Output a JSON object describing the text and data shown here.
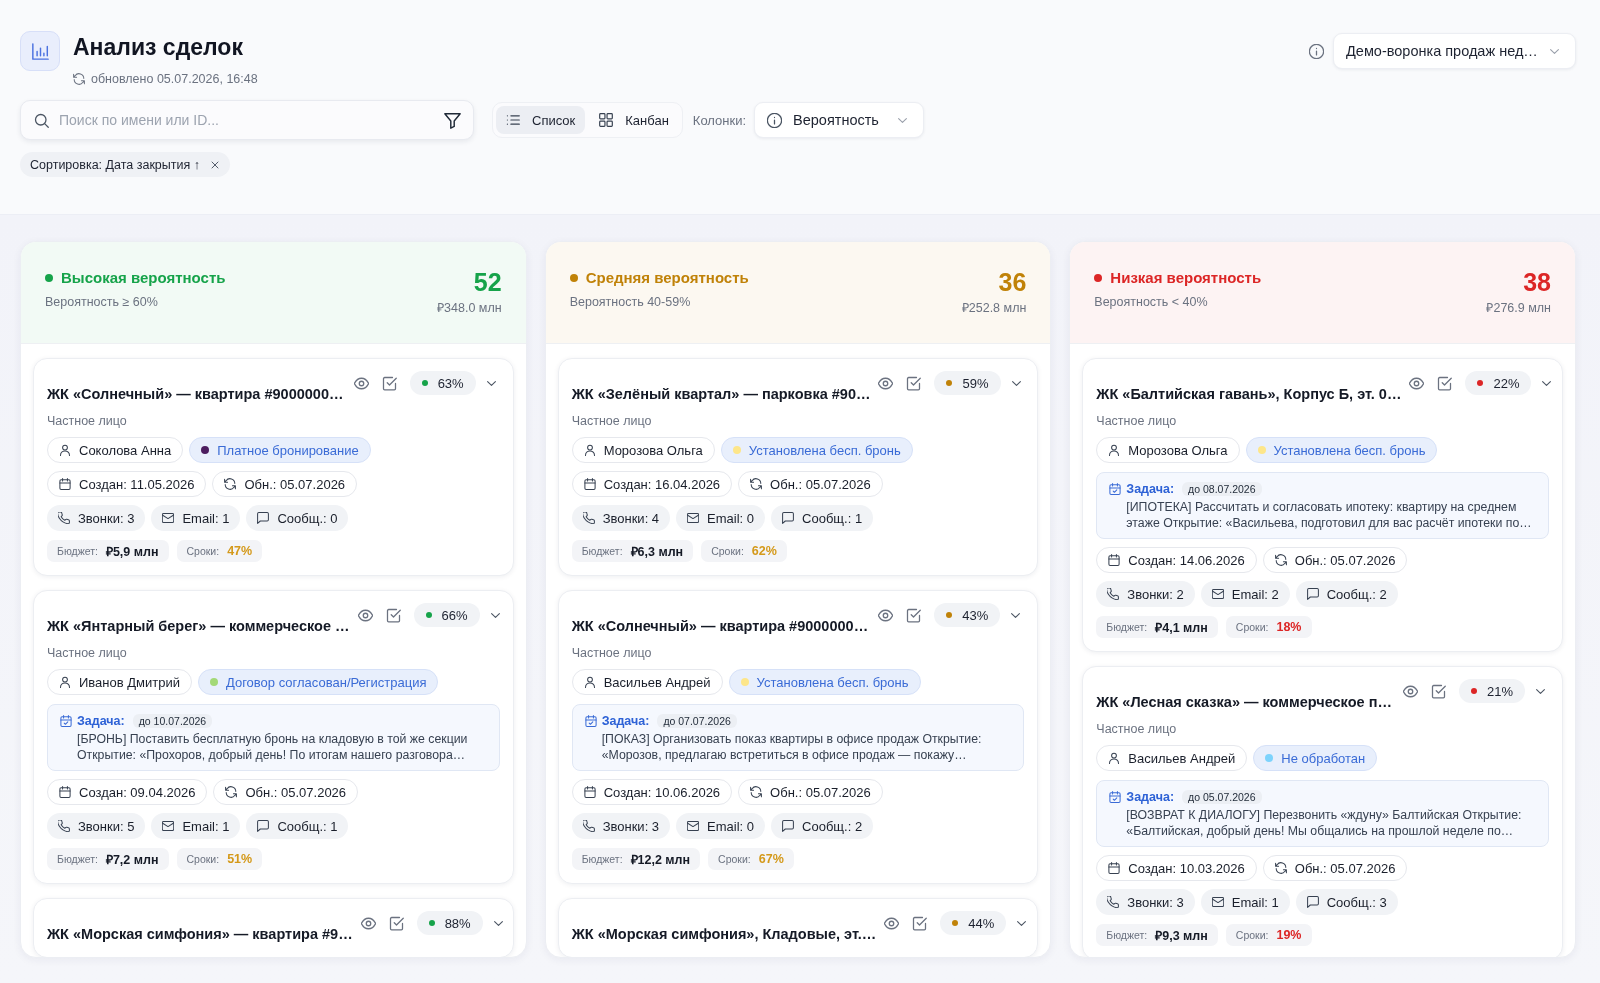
{
  "header": {
    "title": "Анализ сделок",
    "updated": "обновлено 05.07.2026, 16:48",
    "funnel_select": {
      "value": "Демо-воронка продаж нед…"
    }
  },
  "toolbar": {
    "search": {
      "placeholder": "Поиск по имени или ID..."
    },
    "views": [
      {
        "label": "Список",
        "kind": "list",
        "selected": true
      },
      {
        "label": "Канбан",
        "kind": "kanban",
        "selected": false
      }
    ],
    "columns_label": "Колонки:",
    "columns_select": {
      "value": "Вероятность"
    }
  },
  "sort_chip": {
    "label": "Сортировка: Дата закрытия ↑"
  },
  "columns": [
    {
      "title": "Высокая вероятность",
      "subtitle": "Вероятность ≥ 60%",
      "count": "52",
      "sum": "₽348.0 млн",
      "color": "#16a34a",
      "cards": [
        {
          "title": "ЖК «Солнечный» — квартира #9000000…",
          "probability": "63%",
          "client_type": "Частное лицо",
          "person": "Соколова Анна",
          "status": {
            "label": "Платное бронирование",
            "color": "#4c1d5f"
          },
          "created": "Создан: 11.05.2026",
          "updated": "Обн.: 05.07.2026",
          "calls": "Звонки: 3",
          "emails": "Email: 1",
          "messages": "Сообщ.: 0",
          "budget": {
            "label": "Бюджет:",
            "value": "₽5,9 млн"
          },
          "deadline": {
            "label": "Сроки:",
            "value": "47%",
            "color": "#d4991a"
          }
        },
        {
          "title": "ЖК «Янтарный берег» — коммерческое …",
          "probability": "66%",
          "client_type": "Частное лицо",
          "person": "Иванов Дмитрий",
          "status": {
            "label": "Договор согласован/Регистрация",
            "color": "#a3d977"
          },
          "task": {
            "label": "Задача:",
            "due": "до 10.07.2026",
            "lines": [
              "[БРОНЬ] Поставить бесплатную бронь на кладовую в той же секции",
              "Открытие: «Прохоров, добрый день! По итогам нашего разговора…"
            ]
          },
          "created": "Создан: 09.04.2026",
          "updated": "Обн.: 05.07.2026",
          "calls": "Звонки: 5",
          "emails": "Email: 1",
          "messages": "Сообщ.: 1",
          "budget": {
            "label": "Бюджет:",
            "value": "₽7,2 млн"
          },
          "deadline": {
            "label": "Сроки:",
            "value": "51%",
            "color": "#d4991a"
          }
        },
        {
          "title": "ЖК «Морская симфония» — квартира #9…",
          "probability": "88%"
        }
      ]
    },
    {
      "title": "Средняя вероятность",
      "subtitle": "Вероятность 40-59%",
      "count": "36",
      "sum": "₽252.8 млн",
      "color": "#c08208",
      "cards": [
        {
          "title": "ЖК «Зелёный квартал» — парковка #90…",
          "probability": "59%",
          "client_type": "Частное лицо",
          "person": "Морозова Ольга",
          "status": {
            "label": "Установлена бесп. бронь",
            "color": "#fde68a"
          },
          "created": "Создан: 16.04.2026",
          "updated": "Обн.: 05.07.2026",
          "calls": "Звонки: 4",
          "emails": "Email: 0",
          "messages": "Сообщ.: 1",
          "budget": {
            "label": "Бюджет:",
            "value": "₽6,3 млн"
          },
          "deadline": {
            "label": "Сроки:",
            "value": "62%",
            "color": "#d4991a"
          }
        },
        {
          "title": "ЖК «Солнечный» — квартира #9000000…",
          "probability": "43%",
          "client_type": "Частное лицо",
          "person": "Васильев Андрей",
          "status": {
            "label": "Установлена бесп. бронь",
            "color": "#fde68a"
          },
          "task": {
            "label": "Задача:",
            "due": "до 07.07.2026",
            "lines": [
              "[ПОКАЗ] Организовать показ квартиры в офисе продаж Открытие:",
              "«Морозов, предлагаю встретиться в офисе продаж — покажу…"
            ]
          },
          "created": "Создан: 10.06.2026",
          "updated": "Обн.: 05.07.2026",
          "calls": "Звонки: 3",
          "emails": "Email: 0",
          "messages": "Сообщ.: 2",
          "budget": {
            "label": "Бюджет:",
            "value": "₽12,2 млн"
          },
          "deadline": {
            "label": "Сроки:",
            "value": "67%",
            "color": "#d4991a"
          }
        },
        {
          "title": "ЖК «Морская симфония», Кладовые, эт.…",
          "probability": "44%"
        }
      ]
    },
    {
      "title": "Низкая вероятность",
      "subtitle": "Вероятность < 40%",
      "count": "38",
      "sum": "₽276.9 млн",
      "color": "#dc2626",
      "cards": [
        {
          "title": "ЖК «Балтийская гавань», Корпус Б, эт. 0…",
          "probability": "22%",
          "client_type": "Частное лицо",
          "person": "Морозова Ольга",
          "status": {
            "label": "Установлена бесп. бронь",
            "color": "#fde68a"
          },
          "task": {
            "label": "Задача:",
            "due": "до 08.07.2026",
            "lines": [
              "[ИПОТЕКА] Рассчитать и согласовать ипотеку: квартиру на среднем",
              "этаже Открытие: «Васильева, подготовил для вас расчёт ипотеки по…"
            ]
          },
          "created": "Создан: 14.06.2026",
          "updated": "Обн.: 05.07.2026",
          "calls": "Звонки: 2",
          "emails": "Email: 2",
          "messages": "Сообщ.: 2",
          "budget": {
            "label": "Бюджет:",
            "value": "₽4,1 млн"
          },
          "deadline": {
            "label": "Сроки:",
            "value": "18%",
            "color": "#dc2626"
          }
        },
        {
          "title": "ЖК «Лесная сказка» — коммерческое п…",
          "probability": "21%",
          "client_type": "Частное лицо",
          "person": "Васильев Андрей",
          "status": {
            "label": "Не обработан",
            "color": "#7dd3fc"
          },
          "task": {
            "label": "Задача:",
            "due": "до 05.07.2026",
            "lines": [
              "[ВОЗВРАТ К ДИАЛОГУ] Перезвонить «ждуну» Балтийская Открытие:",
              "«Балтийская, добрый день! Мы общались на прошлой неделе по…"
            ]
          },
          "created": "Создан: 10.03.2026",
          "updated": "Обн.: 05.07.2026",
          "calls": "Звонки: 3",
          "emails": "Email: 1",
          "messages": "Сообщ.: 3",
          "budget": {
            "label": "Бюджет:",
            "value": "₽9,3 млн"
          },
          "deadline": {
            "label": "Сроки:",
            "value": "19%",
            "color": "#dc2626"
          }
        }
      ]
    }
  ]
}
